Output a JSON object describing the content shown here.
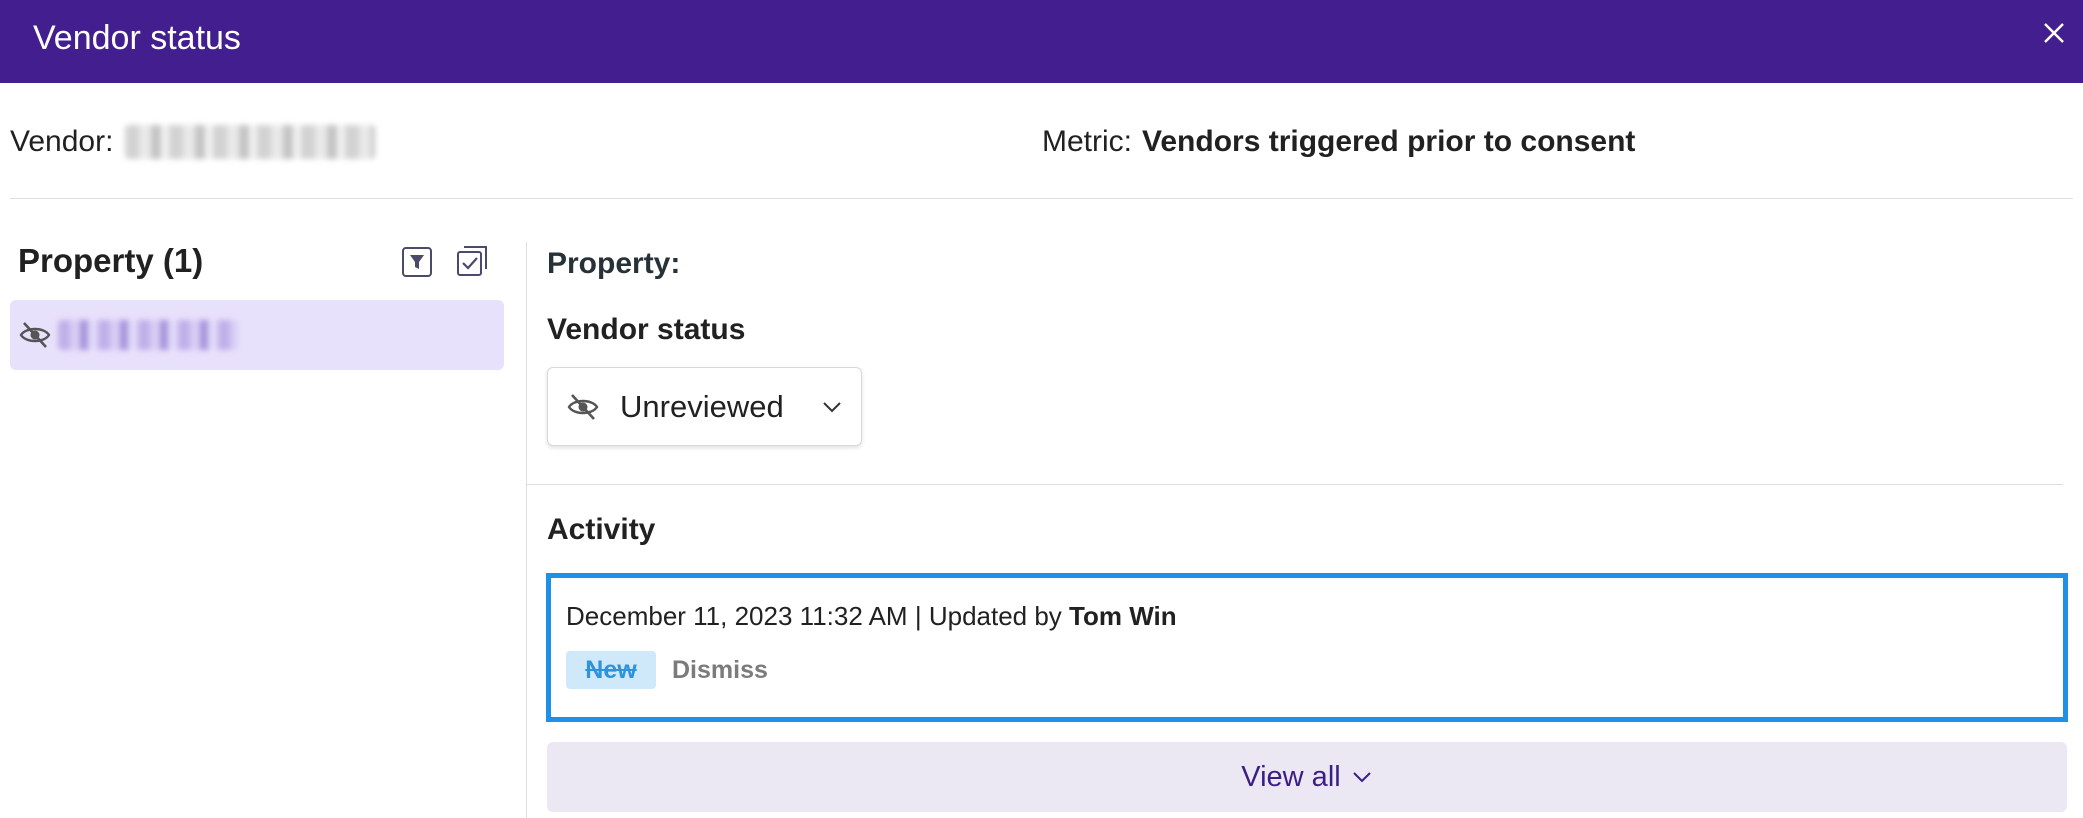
{
  "header": {
    "title": "Vendor status",
    "background_color": "#421e8f"
  },
  "vendor": {
    "label": "Vendor:"
  },
  "metric": {
    "label": "Metric:",
    "value": "Vendors triggered prior to consent"
  },
  "left_panel": {
    "title": "Property (1)",
    "filter_icon": "filter-icon",
    "select_icon": "select-all-icon",
    "items": [
      {
        "icon": "eye-off-icon",
        "selected": true
      }
    ]
  },
  "right_panel": {
    "property_label": "Property:",
    "vendor_status_heading": "Vendor status",
    "status_select": {
      "icon": "eye-off-icon",
      "value": "Unreviewed"
    },
    "activity_heading": "Activity",
    "activity": {
      "timestamp": "December 11, 2023 11:32 AM",
      "separator": "|",
      "updated_by_label": "Updated by",
      "user": "Tom Win",
      "old_status": "New",
      "new_status": "Dismiss",
      "highlight_color": "#1e90e6"
    },
    "view_all_label": "View all"
  }
}
